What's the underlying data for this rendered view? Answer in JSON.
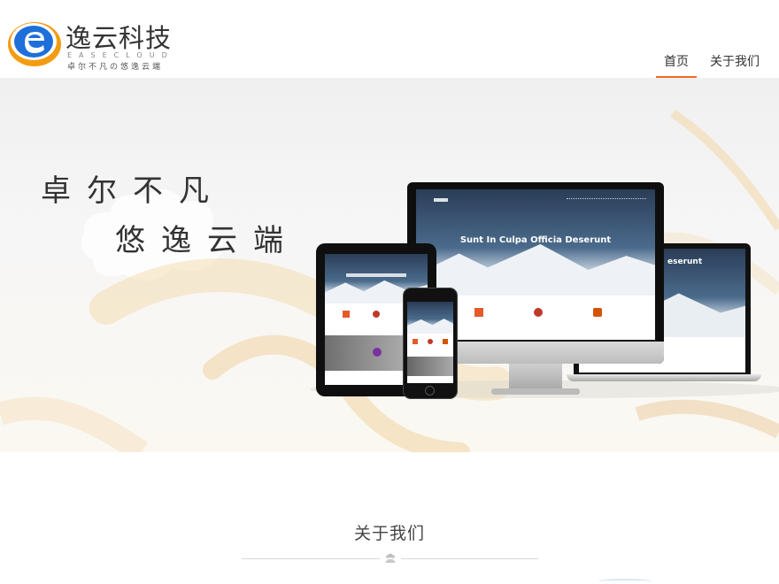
{
  "brand": {
    "name": "逸云科技",
    "name_en": "EASECLOUD",
    "slogan": "卓尔不凡の悠逸云端",
    "accent": "#ef6a25",
    "logo_blue": "#1e6fd9",
    "logo_orange": "#f39c12"
  },
  "nav": {
    "items": [
      {
        "label": "首页",
        "active": true
      },
      {
        "label": "关于我们",
        "active": false
      }
    ]
  },
  "banner": {
    "line1": "卓尔不凡",
    "line2": "悠逸云端",
    "mockup_headline": "Sunt In Culpa Officia Deserunt",
    "mockup_headline_right": "eserunt"
  },
  "about": {
    "title": "关于我们"
  }
}
